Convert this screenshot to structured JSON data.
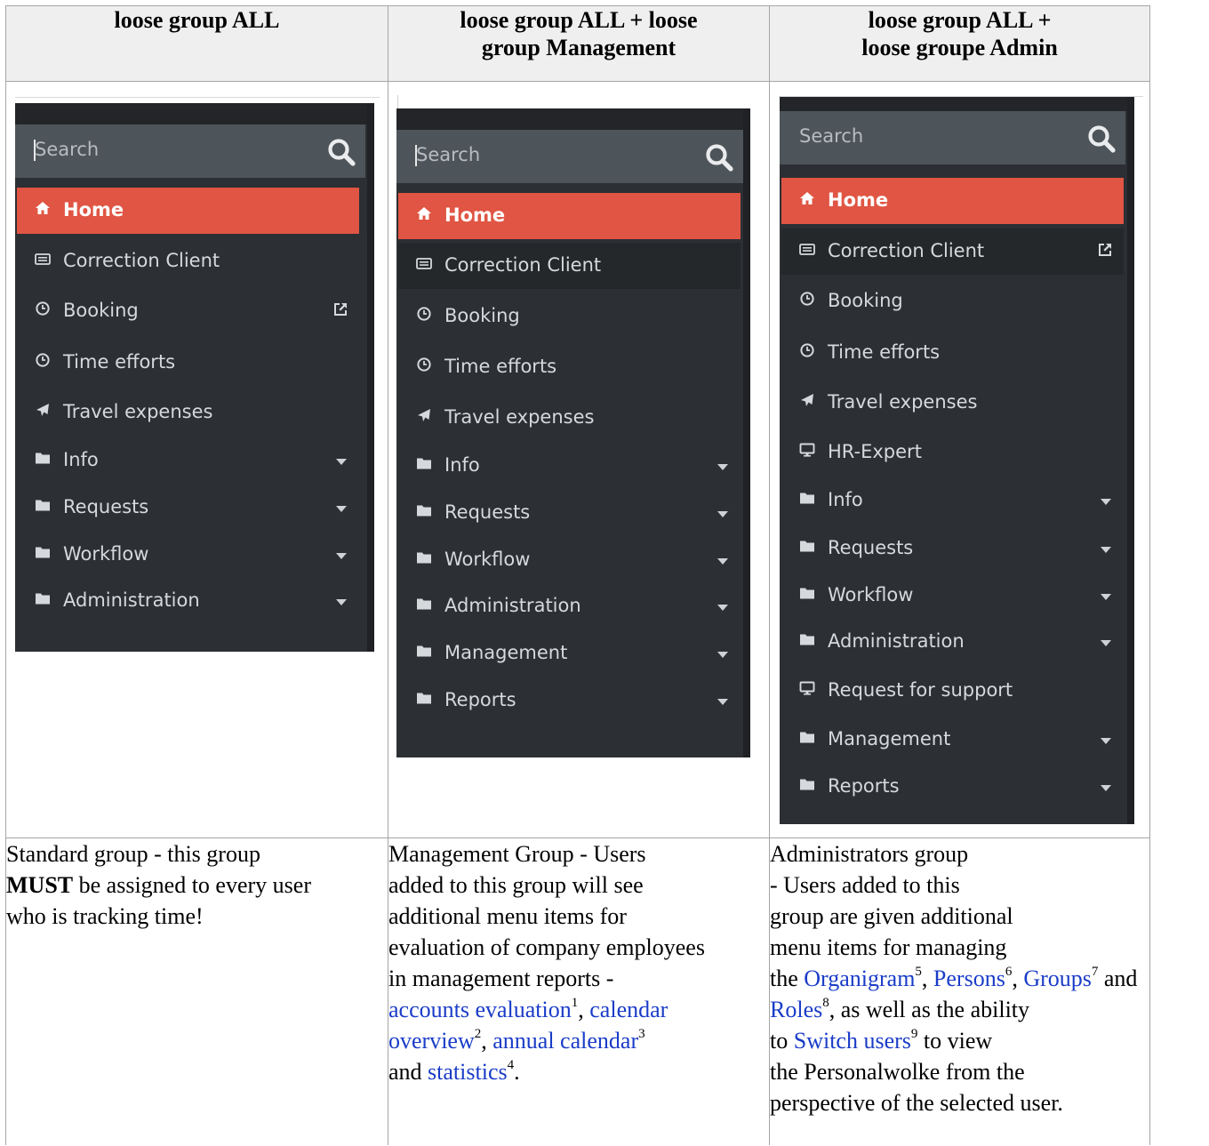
{
  "headers": {
    "col1": "loose group ALL",
    "col2_l1": "loose group ALL + loose",
    "col2_l2": "group Management",
    "col3_l1": "loose group ALL +",
    "col3_l2": "loose groupe Admin"
  },
  "menu": {
    "search_placeholder": "Search",
    "home": "Home",
    "correction_client": "Correction Client",
    "booking": "Booking",
    "time_efforts": "Time efforts",
    "travel_expenses": "Travel expenses",
    "hr_expert": "HR-Expert",
    "info": "Info",
    "requests": "Requests",
    "workflow": "Workflow",
    "administration": "Administration",
    "request_for_support": "Request for support",
    "management": "Management",
    "reports": "Reports"
  },
  "desc1": {
    "l1": "Standard group - this group",
    "must": "MUST",
    "l2_rest": " be assigned to every user",
    "l3": "who is tracking time!"
  },
  "desc2": {
    "l1": "Management Group - Users",
    "l2": "added to this group will see",
    "l3": "additional menu items for",
    "l4": "evaluation of company employees",
    "l5": "in management reports -",
    "link1": "accounts evaluation",
    "sup1": "1",
    "sep1": ", ",
    "link2a": "calendar",
    "link2b": "overview",
    "sup2": "2",
    "sep2": ", ",
    "link3": "annual calendar",
    "sup3": "3",
    "and": "and ",
    "link4": "statistics",
    "sup4": "4",
    "end": "."
  },
  "desc3": {
    "l1": "Administrators group",
    "l2": "- Users added to this",
    "l3": "group are given additional",
    "l4": "menu items for managing",
    "the": "the ",
    "link5": "Organigram",
    "sup5": "5",
    "sep5": ", ",
    "link6": "Persons",
    "sup6": "6",
    "sep6": ", ",
    "link7": "Groups",
    "sup7": "7",
    "and7": " and",
    "link8": "Roles",
    "sup8": "8",
    "rest8": ", as well as the ability",
    "to": "to ",
    "link9": "Switch users",
    "sup9": "9",
    "rest9": " to view",
    "l9": "the Personalwolke from the",
    "l10": "perspective of the selected user."
  },
  "colors": {
    "menu_bg": "#2c2f33",
    "search_bg": "#4d545a",
    "active": "#e05543",
    "link": "#1a3cc8"
  },
  "icons": [
    "home-icon",
    "keyboard-icon",
    "clock-icon",
    "plane-icon",
    "monitor-icon",
    "folder-icon",
    "search-icon",
    "external-link-icon",
    "caret-down-icon"
  ]
}
